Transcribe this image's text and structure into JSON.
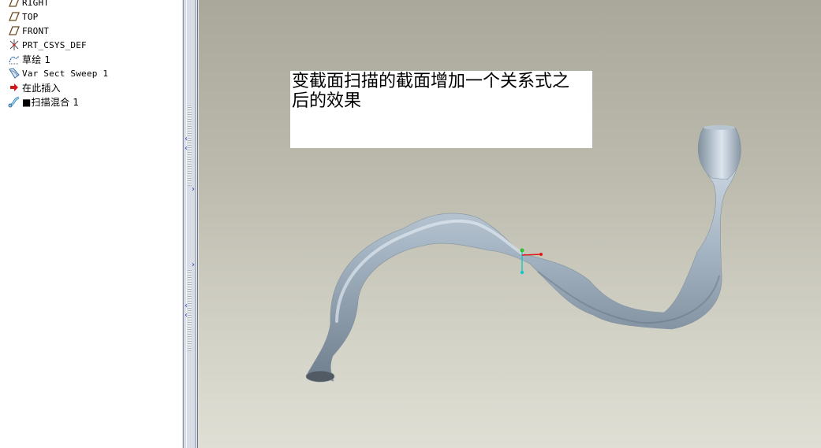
{
  "model_tree": {
    "items": [
      {
        "label": "RIGHT",
        "icon": "datum-plane-icon"
      },
      {
        "label": "TOP",
        "icon": "datum-plane-icon"
      },
      {
        "label": "FRONT",
        "icon": "datum-plane-icon"
      },
      {
        "label": "PRT_CSYS_DEF",
        "icon": "coordinate-system-icon"
      },
      {
        "label": "草绘 1",
        "icon": "sketch-icon"
      },
      {
        "label": "Var Sect Sweep 1",
        "icon": "var-sect-sweep-icon"
      },
      {
        "label": "在此插入",
        "icon": "insert-here-arrow-icon"
      },
      {
        "label": "■扫描混合 1",
        "icon": "swept-blend-icon"
      }
    ]
  },
  "viewport": {
    "note_text": "变截面扫描的截面增加一个关系式之后的效果",
    "colors": {
      "background_top": "#a9a89b",
      "background_bottom": "#e0dfd5",
      "model": "#a7b6c3"
    }
  }
}
